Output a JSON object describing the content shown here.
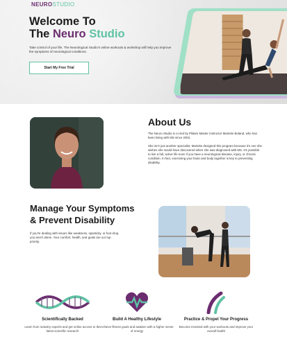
{
  "brand": {
    "logo_primary": "NEURO",
    "logo_secondary": "STUDIO",
    "purple": "#6b2d6f",
    "mint": "#5fc2a4"
  },
  "hero": {
    "title_line1": "Welcome To",
    "title_the": "The",
    "title_neuro": "Neuro",
    "title_studio": "Studio",
    "description": "Take control of your life. The Neurological Studio's online workouts & workshop will help you improve the symptoms of neurological conditions.",
    "cta_label": "Start My Free Trial",
    "image_icon": "pilates-class-photo"
  },
  "about": {
    "title": "About Us",
    "paragraph1": "The Neuro Studio is co-led by Pilates Master Instructor Marieke Boland, who has been living with MS since 2002.",
    "paragraph2": "She isn't just another specialist, Marieke designed this program because it's one she wishes she would have discovered when she was diagnosed with MS. It's possible to live a full, active life even if you have a neurological disease, injury, or chronic condition. In fact, exercising your brain and body together is key to preventing disability.",
    "image_icon": "instructor-portrait-photo"
  },
  "symptoms": {
    "title_line1": "Manage Your Symptoms",
    "title_line2": "& Prevent Disability",
    "description": "If you're dealing with issues like weakness, spasticity, or foot drop, you aren't alone. Your comfort, health, and goals are our top priority.",
    "image_icon": "barre-exercise-photo"
  },
  "features": [
    {
      "icon": "dna-icon",
      "title": "Scientifically Backed",
      "description": "Learn from industry experts and get online access to the latest scientific research"
    },
    {
      "icon": "heart-icon",
      "title": "Build A Healthy Lifestyle",
      "description": "Achieve fitness goals and awaken with a higher sense of energy"
    },
    {
      "icon": "growth-icon",
      "title": "Practice & Propel Your Progress",
      "description": "Become invested with your workouts and improve your overall health"
    }
  ]
}
